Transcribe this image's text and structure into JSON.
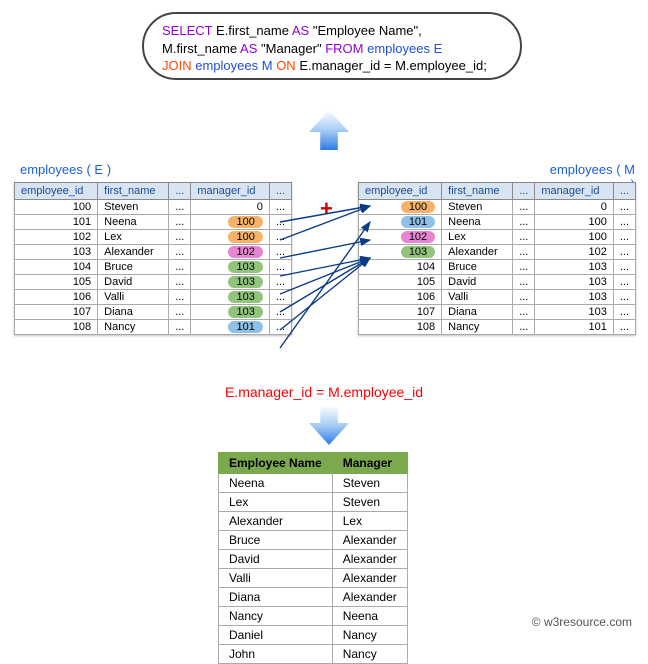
{
  "sql": {
    "select": "SELECT",
    "e_col": "E.first_name",
    "as1": "AS",
    "alias1": "\"Employee Name\"",
    "comma": ",",
    "m_col": "M.first_name",
    "as2": "AS",
    "alias2": "\"Manager\"",
    "from": "FROM",
    "tbl1": "employees E",
    "join": "JOIN",
    "tbl2": "employees M",
    "on": "ON",
    "cond": "E.manager_id = M.employee_id",
    "semi": ";"
  },
  "labels": {
    "left": "employees ( E )",
    "right": "employees ( M )",
    "plus": "+",
    "join_text": "E.manager_id = M.employee_id"
  },
  "headers": {
    "emp_id": "employee_id",
    "fname": "first_name",
    "mgr_id": "manager_id"
  },
  "rowsE": [
    {
      "emp": "100",
      "name": "Steven",
      "mgr": "0",
      "pill": ""
    },
    {
      "emp": "101",
      "name": "Neena",
      "mgr": "100",
      "pill": "c-orange"
    },
    {
      "emp": "102",
      "name": "Lex",
      "mgr": "100",
      "pill": "c-orange"
    },
    {
      "emp": "103",
      "name": "Alexander",
      "mgr": "102",
      "pill": "c-pink"
    },
    {
      "emp": "104",
      "name": "Bruce",
      "mgr": "103",
      "pill": "c-green"
    },
    {
      "emp": "105",
      "name": "David",
      "mgr": "103",
      "pill": "c-green"
    },
    {
      "emp": "106",
      "name": "Valli",
      "mgr": "103",
      "pill": "c-green"
    },
    {
      "emp": "107",
      "name": "Diana",
      "mgr": "103",
      "pill": "c-green"
    },
    {
      "emp": "108",
      "name": "Nancy",
      "mgr": "101",
      "pill": "c-blue"
    }
  ],
  "rowsM": [
    {
      "emp": "100",
      "name": "Steven",
      "mgr": "0",
      "pill": "c-orange"
    },
    {
      "emp": "101",
      "name": "Neena",
      "mgr": "100",
      "pill": "c-blue"
    },
    {
      "emp": "102",
      "name": "Lex",
      "mgr": "100",
      "pill": "c-pink"
    },
    {
      "emp": "103",
      "name": "Alexander",
      "mgr": "102",
      "pill": "c-green"
    },
    {
      "emp": "104",
      "name": "Bruce",
      "mgr": "103",
      "pill": ""
    },
    {
      "emp": "105",
      "name": "David",
      "mgr": "103",
      "pill": ""
    },
    {
      "emp": "106",
      "name": "Valli",
      "mgr": "103",
      "pill": ""
    },
    {
      "emp": "107",
      "name": "Diana",
      "mgr": "103",
      "pill": ""
    },
    {
      "emp": "108",
      "name": "Nancy",
      "mgr": "101",
      "pill": ""
    }
  ],
  "result_headers": {
    "c1": "Employee Name",
    "c2": "Manager"
  },
  "result_rows": [
    {
      "e": "Neena",
      "m": "Steven"
    },
    {
      "e": "Lex",
      "m": "Steven"
    },
    {
      "e": "Alexander",
      "m": "Lex"
    },
    {
      "e": "Bruce",
      "m": "Alexander"
    },
    {
      "e": "David",
      "m": "Alexander"
    },
    {
      "e": "Valli",
      "m": "Alexander"
    },
    {
      "e": "Diana",
      "m": "Alexander"
    },
    {
      "e": "Nancy",
      "m": "Neena"
    },
    {
      "e": "Daniel",
      "m": "Nancy"
    },
    {
      "e": "John",
      "m": "Nancy"
    }
  ],
  "footer": "© w3resource.com"
}
